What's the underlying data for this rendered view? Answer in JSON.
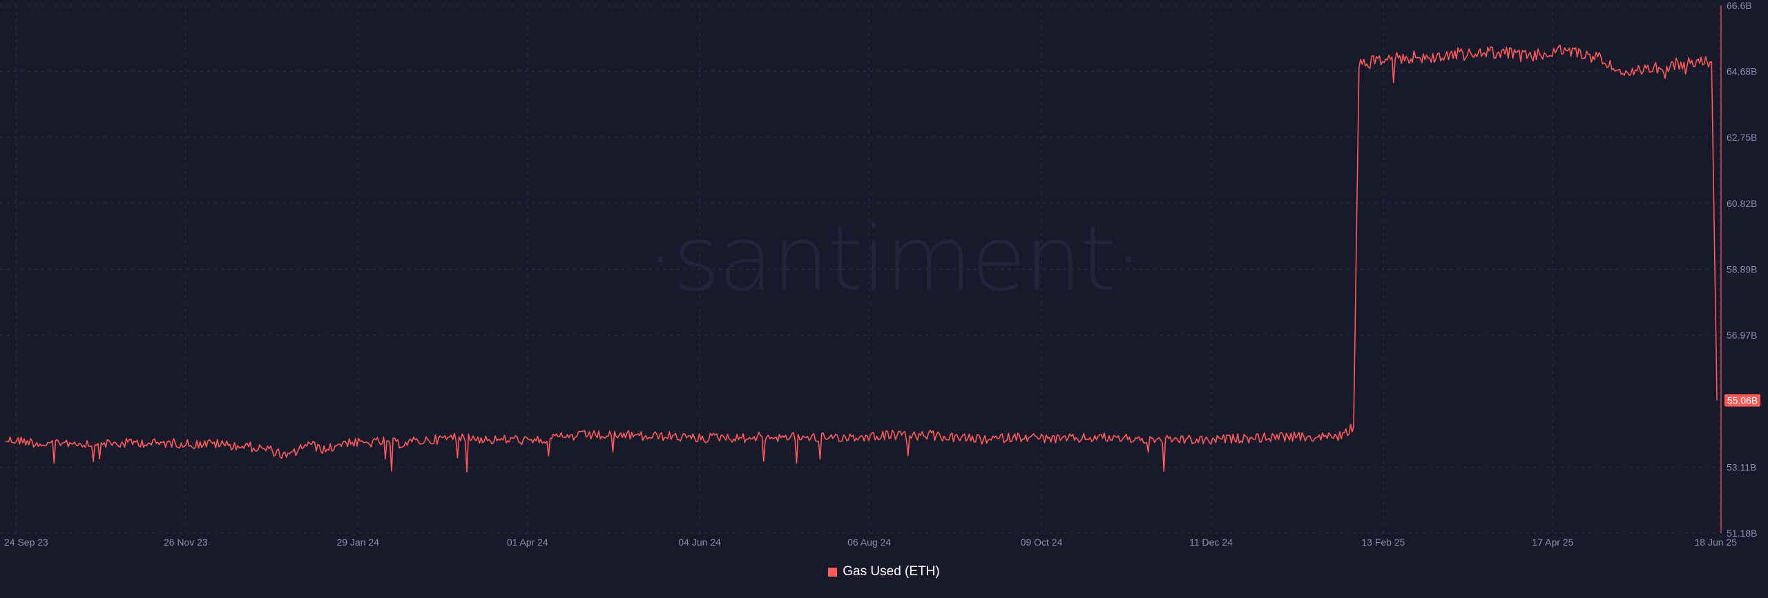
{
  "chart_data": {
    "type": "line",
    "watermark": "·santiment·",
    "series": [
      {
        "name": "Gas Used (ETH)",
        "color": "#ff5b5b",
        "current_value_label": "55.06B",
        "points": [
          [
            "2023-09-20",
            53.9
          ],
          [
            "2023-09-27",
            53.88
          ],
          [
            "2023-10-04",
            53.78
          ],
          [
            "2023-10-11",
            53.85
          ],
          [
            "2023-10-18",
            53.8
          ],
          [
            "2023-10-25",
            53.83
          ],
          [
            "2023-11-01",
            53.78
          ],
          [
            "2023-11-08",
            53.84
          ],
          [
            "2023-11-15",
            53.8
          ],
          [
            "2023-11-22",
            53.82
          ],
          [
            "2023-11-29",
            53.78
          ],
          [
            "2023-12-06",
            53.8
          ],
          [
            "2023-12-13",
            53.75
          ],
          [
            "2023-12-20",
            53.7
          ],
          [
            "2023-12-27",
            53.62
          ],
          [
            "2024-01-03",
            53.4
          ],
          [
            "2024-01-10",
            53.8
          ],
          [
            "2024-01-17",
            53.6
          ],
          [
            "2024-01-24",
            53.85
          ],
          [
            "2024-01-31",
            53.8
          ],
          [
            "2024-02-07",
            53.86
          ],
          [
            "2024-02-14",
            53.8
          ],
          [
            "2024-02-21",
            53.88
          ],
          [
            "2024-02-28",
            53.92
          ],
          [
            "2024-03-06",
            54.0
          ],
          [
            "2024-03-13",
            53.95
          ],
          [
            "2024-03-20",
            53.9
          ],
          [
            "2024-03-27",
            53.93
          ],
          [
            "2024-04-03",
            53.85
          ],
          [
            "2024-04-10",
            53.96
          ],
          [
            "2024-04-17",
            54.0
          ],
          [
            "2024-04-24",
            54.05
          ],
          [
            "2024-05-01",
            54.02
          ],
          [
            "2024-05-08",
            54.05
          ],
          [
            "2024-05-15",
            54.0
          ],
          [
            "2024-05-22",
            54.02
          ],
          [
            "2024-05-29",
            53.98
          ],
          [
            "2024-06-05",
            53.95
          ],
          [
            "2024-06-12",
            54.0
          ],
          [
            "2024-06-19",
            53.95
          ],
          [
            "2024-06-26",
            54.0
          ],
          [
            "2024-07-03",
            53.98
          ],
          [
            "2024-07-10",
            54.02
          ],
          [
            "2024-07-17",
            53.97
          ],
          [
            "2024-07-24",
            54.0
          ],
          [
            "2024-07-31",
            53.98
          ],
          [
            "2024-08-07",
            54.02
          ],
          [
            "2024-08-14",
            54.06
          ],
          [
            "2024-08-21",
            54.0
          ],
          [
            "2024-08-28",
            54.05
          ],
          [
            "2024-09-04",
            53.98
          ],
          [
            "2024-09-11",
            53.95
          ],
          [
            "2024-09-18",
            53.9
          ],
          [
            "2024-09-25",
            53.96
          ],
          [
            "2024-10-02",
            54.0
          ],
          [
            "2024-10-09",
            53.96
          ],
          [
            "2024-10-16",
            53.92
          ],
          [
            "2024-10-23",
            53.95
          ],
          [
            "2024-10-30",
            53.98
          ],
          [
            "2024-11-06",
            53.96
          ],
          [
            "2024-11-13",
            53.94
          ],
          [
            "2024-11-20",
            53.9
          ],
          [
            "2024-11-27",
            53.92
          ],
          [
            "2024-12-04",
            53.9
          ],
          [
            "2024-12-11",
            53.88
          ],
          [
            "2024-12-18",
            53.94
          ],
          [
            "2024-12-25",
            53.96
          ],
          [
            "2025-01-01",
            53.98
          ],
          [
            "2025-01-08",
            54.0
          ],
          [
            "2025-01-15",
            53.98
          ],
          [
            "2025-01-22",
            54.0
          ],
          [
            "2025-01-29",
            54.02
          ],
          [
            "2025-02-02",
            54.3
          ],
          [
            "2025-02-04",
            64.85
          ],
          [
            "2025-02-11",
            65.0
          ],
          [
            "2025-02-18",
            65.05
          ],
          [
            "2025-02-25",
            65.1
          ],
          [
            "2025-03-04",
            65.05
          ],
          [
            "2025-03-11",
            65.2
          ],
          [
            "2025-03-18",
            65.15
          ],
          [
            "2025-03-25",
            65.25
          ],
          [
            "2025-04-01",
            65.2
          ],
          [
            "2025-04-08",
            65.1
          ],
          [
            "2025-04-15",
            65.2
          ],
          [
            "2025-04-22",
            65.3
          ],
          [
            "2025-04-29",
            65.15
          ],
          [
            "2025-05-06",
            65.05
          ],
          [
            "2025-05-13",
            64.5
          ],
          [
            "2025-05-20",
            64.7
          ],
          [
            "2025-05-27",
            64.8
          ],
          [
            "2025-06-03",
            64.9
          ],
          [
            "2025-06-10",
            64.95
          ],
          [
            "2025-06-15",
            64.95
          ],
          [
            "2025-06-17",
            55.06
          ]
        ]
      }
    ],
    "y_ticks": [
      "66.6B",
      "64.68B",
      "62.75B",
      "60.82B",
      "58.89B",
      "56.97B",
      "53.11B",
      "51.18B"
    ],
    "x_ticks": [
      "24 Sep 23",
      "26 Nov 23",
      "29 Jan 24",
      "01 Apr 24",
      "04 Jun 24",
      "06 Aug 24",
      "09 Oct 24",
      "11 Dec 24",
      "13 Feb 25",
      "17 Apr 25",
      "18 Jun 25"
    ],
    "ylim": [
      51.18,
      66.6
    ],
    "grid": true,
    "legend_position": "bottom-center",
    "background": "#181a2b"
  }
}
